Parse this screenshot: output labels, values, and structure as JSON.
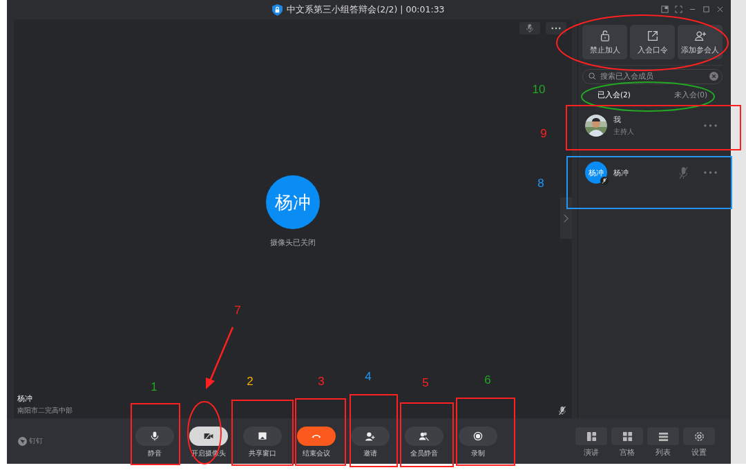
{
  "window": {
    "title": "中文系第三小组答辩会(2/2) | 00:01:33"
  },
  "stage": {
    "avatar_text": "杨冲",
    "caption": "摄像头已关闭",
    "speaker_name": "杨冲",
    "speaker_org": "南阳市二完高中部",
    "muted": true
  },
  "panel": {
    "actions": [
      {
        "kind": "lock",
        "label": "禁止加人"
      },
      {
        "kind": "share",
        "label": "入会口令"
      },
      {
        "kind": "add-user",
        "label": "添加参会人"
      }
    ],
    "search": {
      "placeholder": "搜索已入会成员"
    },
    "tabs": [
      {
        "label": "已入会(2)",
        "selected": true
      },
      {
        "label": "未入会(0)",
        "selected": false
      }
    ],
    "members": [
      {
        "name": "我",
        "role": "主持人",
        "kind": "picture",
        "muted": false
      },
      {
        "name": "杨冲",
        "avatar_text": "杨冲",
        "kind": "text",
        "muted": true
      }
    ]
  },
  "brand": "钉钉",
  "toolbar": [
    {
      "kind": "mic",
      "label": "静音"
    },
    {
      "kind": "camera-off",
      "label": "开启摄像头"
    },
    {
      "kind": "screen",
      "label": "共享窗口"
    },
    {
      "kind": "hangup",
      "label": "结束会议"
    },
    {
      "kind": "invite",
      "label": "邀请"
    },
    {
      "kind": "mute-all",
      "label": "全员静音"
    },
    {
      "kind": "record",
      "label": "录制"
    }
  ],
  "views": [
    {
      "kind": "speaker",
      "label": "演讲"
    },
    {
      "kind": "grid",
      "label": "宫格"
    },
    {
      "kind": "list",
      "label": "列表"
    },
    {
      "kind": "settings",
      "label": "设置"
    }
  ],
  "annotations": [
    {
      "kind": "ellipse",
      "color": "#ff2020"
    },
    {
      "kind": "ellipse",
      "label": "10",
      "color": "#22a822"
    },
    {
      "kind": "box",
      "label": "9",
      "color": "#ff2020"
    },
    {
      "kind": "box",
      "label": "8",
      "color": "#2196f3"
    },
    {
      "kind": "box",
      "label": "1",
      "color": "#22a822"
    },
    {
      "kind": "ellipse-arrow",
      "label": "7",
      "color": "#ff2020"
    },
    {
      "kind": "box",
      "label": "2",
      "color": "#f0b400"
    },
    {
      "kind": "box",
      "label": "3",
      "color": "#ff2020"
    },
    {
      "kind": "box",
      "label": "4",
      "color": "#2196f3"
    },
    {
      "kind": "box",
      "label": "5",
      "color": "#ff2020"
    },
    {
      "kind": "box",
      "label": "6",
      "color": "#22a822"
    }
  ]
}
